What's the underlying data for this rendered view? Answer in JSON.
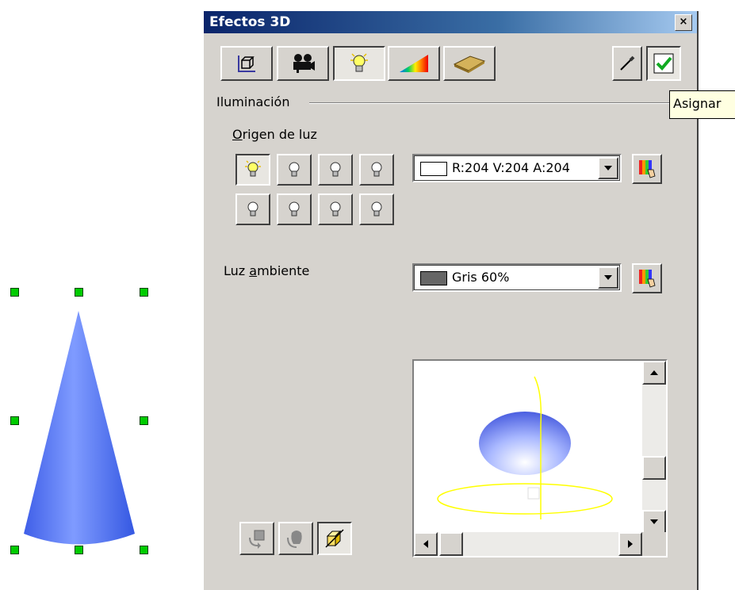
{
  "dialog": {
    "title": "Efectos 3D",
    "close_label": "×",
    "toolbar": {
      "tabs": [
        {
          "name": "geometry",
          "icon": "geometry-cube-icon"
        },
        {
          "name": "shading",
          "icon": "camera-icon"
        },
        {
          "name": "illumination",
          "icon": "lightbulb-icon",
          "selected": true
        },
        {
          "name": "textures",
          "icon": "rainbow-texture-icon"
        },
        {
          "name": "material",
          "icon": "material-bar-icon"
        }
      ],
      "right_buttons": [
        {
          "name": "pipette",
          "icon": "pipette-icon"
        },
        {
          "name": "assign",
          "icon": "checkmark-icon"
        }
      ]
    },
    "section_title": "Iluminación",
    "light_source": {
      "label_prefix": "O",
      "label_rest": "rigen de luz",
      "lamps_count": 8,
      "active_index": 0,
      "color_text": "R:204 V:204 A:204",
      "color_swatch": "#ffffff"
    },
    "ambient_light": {
      "label_prefix": "Luz ",
      "label_underlined": "a",
      "label_rest": "mbiente",
      "color_text": "Gris 60%",
      "color_swatch": "#666666"
    },
    "preview": {
      "sphere_color": "#7b8cf0",
      "guide_color": "#ffff00"
    }
  },
  "tooltip": {
    "text": "Asignar"
  },
  "canvas": {
    "shape": "cone",
    "shape_color": "#5577f2"
  }
}
